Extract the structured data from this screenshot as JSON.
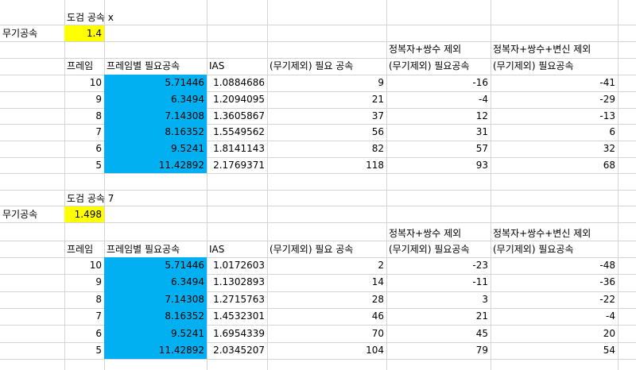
{
  "colors": {
    "yellow": "#ffff00",
    "blue": "#00b0f0",
    "grid": "#d4d4d4"
  },
  "blocks": [
    {
      "title": "도검 공속 x",
      "weapon_label": "무기공속",
      "weapon_value": "1.4",
      "group_header_d": "정복자+쌍수 제외",
      "group_header_e": "정복자+쌍수+변신 제외",
      "columns": [
        "프레임",
        "프레임별 필요공속",
        "IAS",
        "(무기제외) 필요 공속",
        "(무기제외) 필요공속",
        "(무기제외) 필요공속"
      ],
      "rows": [
        [
          "10",
          "5.71446",
          "1.0884686",
          "9",
          "-16",
          "-41"
        ],
        [
          "9",
          "6.3494",
          "1.2094095",
          "21",
          "-4",
          "-29"
        ],
        [
          "8",
          "7.14308",
          "1.3605867",
          "37",
          "12",
          "-13"
        ],
        [
          "7",
          "8.16352",
          "1.5549562",
          "56",
          "31",
          "6"
        ],
        [
          "6",
          "9.5241",
          "1.8141143",
          "82",
          "57",
          "32"
        ],
        [
          "5",
          "11.42892",
          "2.1769371",
          "118",
          "93",
          "68"
        ]
      ]
    },
    {
      "title": "도검 공속 7",
      "weapon_label": "무기공속",
      "weapon_value": "1.498",
      "group_header_d": "정복자+쌍수 제외",
      "group_header_e": "정복자+쌍수+변신 제외",
      "columns": [
        "프레임",
        "프레임별 필요공속",
        "IAS",
        "(무기제외) 필요 공속",
        "(무기제외) 필요공속",
        "(무기제외) 필요공속"
      ],
      "rows": [
        [
          "10",
          "5.71446",
          "1.0172603",
          "2",
          "-23",
          "-48"
        ],
        [
          "9",
          "6.3494",
          "1.1302893",
          "14",
          "-11",
          "-36"
        ],
        [
          "8",
          "7.14308",
          "1.2715763",
          "28",
          "3",
          "-22"
        ],
        [
          "7",
          "8.16352",
          "1.4532301",
          "46",
          "21",
          "-4"
        ],
        [
          "6",
          "9.5241",
          "1.6954339",
          "70",
          "45",
          "20"
        ],
        [
          "5",
          "11.42892",
          "2.0345207",
          "104",
          "79",
          "54"
        ]
      ]
    }
  ]
}
